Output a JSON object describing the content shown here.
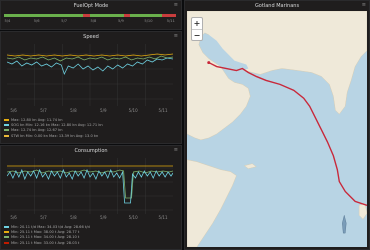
{
  "fuelopt": {
    "title": "FuelOpt Mode",
    "ticks": [
      "5/4",
      "5/6",
      "5/7",
      "5/8",
      "5/9",
      "5/10",
      "5/11"
    ],
    "strip_colors": {
      "on": "#6ab04c",
      "off": "#c93d3d"
    }
  },
  "speed": {
    "title": "Speed",
    "x_ticks": [
      "5/6",
      "5/7",
      "5/8",
      "5/9",
      "5/10",
      "5/11"
    ],
    "legend": [
      {
        "color": "#e5ac0e",
        "text": "Max: 12.80 kn  Avg: 11.74 kn"
      },
      {
        "color": "#6ed0e0",
        "text": "SOG kn  Min: 12.16 kn  Max: 12.80 kn  Avg: 12.71 kn"
      },
      {
        "color": "#7eb26d",
        "text": "Max: 12.74 kn  Avg: 12.67 kn"
      },
      {
        "color": "#eab839",
        "text": "STW kn  Min: 0.00 kn  Max: 13.39 kn  Avg: 13.0 kn"
      }
    ]
  },
  "consumption": {
    "title": "Consumption",
    "x_ticks": [
      "5/6",
      "5/7",
      "5/8",
      "5/9",
      "5/10",
      "5/11"
    ],
    "legend": [
      {
        "color": "#6ed0e0",
        "text": "Min: 20.11 t/d  Max: 34.03 t/d  Avg: 28.66 t/d"
      },
      {
        "color": "#e5ac0e",
        "text": "Min: 25.11 t  Max: 38.00 t  Avg: 28.77 t"
      },
      {
        "color": "#7eb26d",
        "text": "Min: 25.11 t  Max: 34.00 t  Avg: 28.10 t"
      },
      {
        "color": "#bf1b00",
        "text": "Min: 25.11 t  Max: 33.00 t  Avg: 28.03 t"
      }
    ]
  },
  "map": {
    "title": "Gotland Marinans",
    "zoom_in": "+",
    "zoom_out": "−",
    "route_color": "#c8283a",
    "land_color": "#efe9d9",
    "water_color": "#b8d4e4"
  },
  "icons": {
    "menu": "≡"
  }
}
